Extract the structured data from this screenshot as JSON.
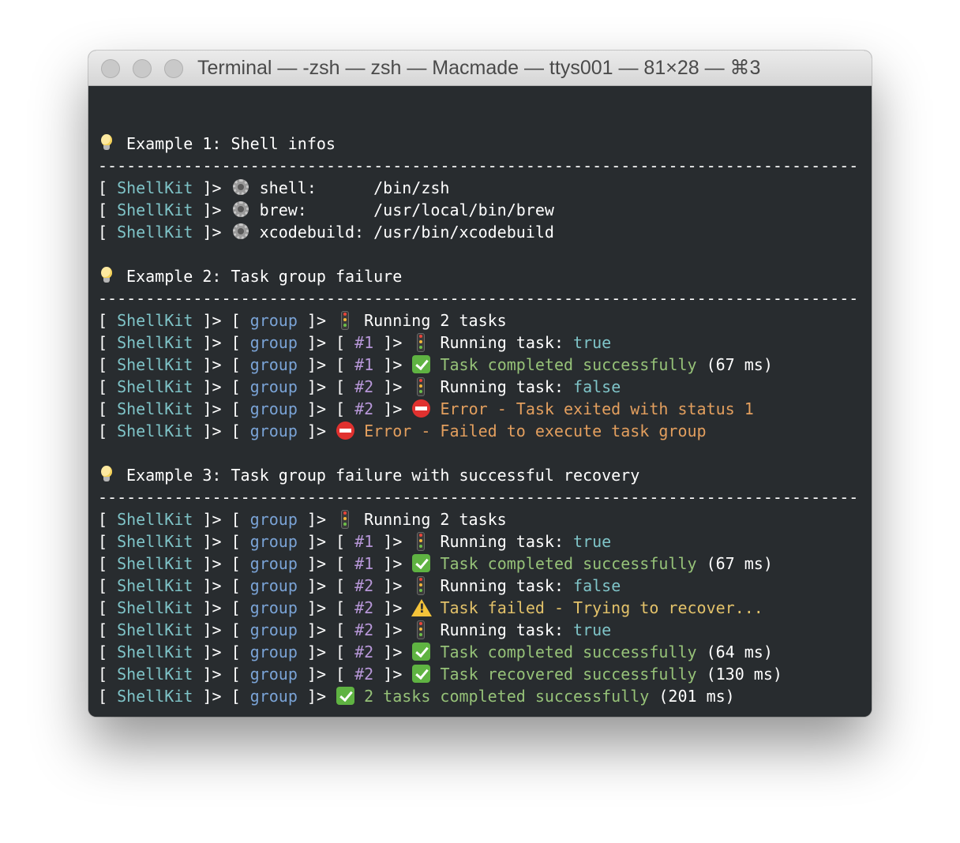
{
  "window": {
    "title": "Terminal — -zsh — zsh — Macmade — ttys001 — 81×28 — ⌘3"
  },
  "prefix": {
    "open": "[ ",
    "name": "ShellKit",
    "close": " ]>"
  },
  "separator": "--------------------------------------------------------------------------------",
  "lines": [
    {
      "type": "blank"
    },
    {
      "type": "segs",
      "segs": [
        [
          "emo",
          "bulb-icon"
        ],
        [
          "w",
          " Example 1: Shell infos"
        ]
      ]
    },
    {
      "type": "sep"
    },
    {
      "type": "segs",
      "segs": [
        [
          "prefix"
        ],
        [
          "w",
          " "
        ],
        [
          "emo",
          "gear-icon"
        ],
        [
          "w",
          " shell:      /bin/zsh"
        ]
      ]
    },
    {
      "type": "segs",
      "segs": [
        [
          "prefix"
        ],
        [
          "w",
          " "
        ],
        [
          "emo",
          "gear-icon"
        ],
        [
          "w",
          " brew:       /usr/local/bin/brew"
        ]
      ]
    },
    {
      "type": "segs",
      "segs": [
        [
          "prefix"
        ],
        [
          "w",
          " "
        ],
        [
          "emo",
          "gear-icon"
        ],
        [
          "w",
          " xcodebuild: /usr/bin/xcodebuild"
        ]
      ]
    },
    {
      "type": "blank"
    },
    {
      "type": "segs",
      "segs": [
        [
          "emo",
          "bulb-icon"
        ],
        [
          "w",
          " Example 2: Task group failure"
        ]
      ]
    },
    {
      "type": "sep"
    },
    {
      "type": "segs",
      "segs": [
        [
          "prefix"
        ],
        [
          "w",
          " [ "
        ],
        [
          "blue",
          "group"
        ],
        [
          "w",
          " ]> "
        ],
        [
          "emo",
          "traffic-light-icon"
        ],
        [
          "w",
          " Running 2 tasks"
        ]
      ]
    },
    {
      "type": "segs",
      "segs": [
        [
          "prefix"
        ],
        [
          "w",
          " [ "
        ],
        [
          "blue",
          "group"
        ],
        [
          "w",
          " ]> [ "
        ],
        [
          "purple",
          "#1"
        ],
        [
          "w",
          " ]> "
        ],
        [
          "emo",
          "traffic-light-icon"
        ],
        [
          "w",
          " Running task: "
        ],
        [
          "cyan",
          "true"
        ]
      ]
    },
    {
      "type": "segs",
      "segs": [
        [
          "prefix"
        ],
        [
          "w",
          " [ "
        ],
        [
          "blue",
          "group"
        ],
        [
          "w",
          " ]> [ "
        ],
        [
          "purple",
          "#1"
        ],
        [
          "w",
          " ]> "
        ],
        [
          "emo",
          "check-icon"
        ],
        [
          "green",
          " Task completed successfully"
        ],
        [
          "w",
          " (67 ms)"
        ]
      ]
    },
    {
      "type": "segs",
      "segs": [
        [
          "prefix"
        ],
        [
          "w",
          " [ "
        ],
        [
          "blue",
          "group"
        ],
        [
          "w",
          " ]> [ "
        ],
        [
          "purple",
          "#2"
        ],
        [
          "w",
          " ]> "
        ],
        [
          "emo",
          "traffic-light-icon"
        ],
        [
          "w",
          " Running task: "
        ],
        [
          "cyan",
          "false"
        ]
      ]
    },
    {
      "type": "segs",
      "segs": [
        [
          "prefix"
        ],
        [
          "w",
          " [ "
        ],
        [
          "blue",
          "group"
        ],
        [
          "w",
          " ]> [ "
        ],
        [
          "purple",
          "#2"
        ],
        [
          "w",
          " ]> "
        ],
        [
          "emo",
          "no-entry-icon"
        ],
        [
          "orange",
          " Error - Task exited with status 1"
        ]
      ]
    },
    {
      "type": "segs",
      "segs": [
        [
          "prefix"
        ],
        [
          "w",
          " [ "
        ],
        [
          "blue",
          "group"
        ],
        [
          "w",
          " ]> "
        ],
        [
          "emo",
          "no-entry-icon"
        ],
        [
          "orange",
          " Error - Failed to execute task group"
        ]
      ]
    },
    {
      "type": "blank"
    },
    {
      "type": "segs",
      "segs": [
        [
          "emo",
          "bulb-icon"
        ],
        [
          "w",
          " Example 3: Task group failure with successful recovery"
        ]
      ]
    },
    {
      "type": "sep"
    },
    {
      "type": "segs",
      "segs": [
        [
          "prefix"
        ],
        [
          "w",
          " [ "
        ],
        [
          "blue",
          "group"
        ],
        [
          "w",
          " ]> "
        ],
        [
          "emo",
          "traffic-light-icon"
        ],
        [
          "w",
          " Running 2 tasks"
        ]
      ]
    },
    {
      "type": "segs",
      "segs": [
        [
          "prefix"
        ],
        [
          "w",
          " [ "
        ],
        [
          "blue",
          "group"
        ],
        [
          "w",
          " ]> [ "
        ],
        [
          "purple",
          "#1"
        ],
        [
          "w",
          " ]> "
        ],
        [
          "emo",
          "traffic-light-icon"
        ],
        [
          "w",
          " Running task: "
        ],
        [
          "cyan",
          "true"
        ]
      ]
    },
    {
      "type": "segs",
      "segs": [
        [
          "prefix"
        ],
        [
          "w",
          " [ "
        ],
        [
          "blue",
          "group"
        ],
        [
          "w",
          " ]> [ "
        ],
        [
          "purple",
          "#1"
        ],
        [
          "w",
          " ]> "
        ],
        [
          "emo",
          "check-icon"
        ],
        [
          "green",
          " Task completed successfully"
        ],
        [
          "w",
          " (67 ms)"
        ]
      ]
    },
    {
      "type": "segs",
      "segs": [
        [
          "prefix"
        ],
        [
          "w",
          " [ "
        ],
        [
          "blue",
          "group"
        ],
        [
          "w",
          " ]> [ "
        ],
        [
          "purple",
          "#2"
        ],
        [
          "w",
          " ]> "
        ],
        [
          "emo",
          "traffic-light-icon"
        ],
        [
          "w",
          " Running task: "
        ],
        [
          "cyan",
          "false"
        ]
      ]
    },
    {
      "type": "segs",
      "segs": [
        [
          "prefix"
        ],
        [
          "w",
          " [ "
        ],
        [
          "blue",
          "group"
        ],
        [
          "w",
          " ]> [ "
        ],
        [
          "purple",
          "#2"
        ],
        [
          "w",
          " ]> "
        ],
        [
          "emo",
          "warning-icon"
        ],
        [
          "yellow",
          " Task failed - Trying to recover..."
        ]
      ]
    },
    {
      "type": "segs",
      "segs": [
        [
          "prefix"
        ],
        [
          "w",
          " [ "
        ],
        [
          "blue",
          "group"
        ],
        [
          "w",
          " ]> [ "
        ],
        [
          "purple",
          "#2"
        ],
        [
          "w",
          " ]> "
        ],
        [
          "emo",
          "traffic-light-icon"
        ],
        [
          "w",
          " Running task: "
        ],
        [
          "cyan",
          "true"
        ]
      ]
    },
    {
      "type": "segs",
      "segs": [
        [
          "prefix"
        ],
        [
          "w",
          " [ "
        ],
        [
          "blue",
          "group"
        ],
        [
          "w",
          " ]> [ "
        ],
        [
          "purple",
          "#2"
        ],
        [
          "w",
          " ]> "
        ],
        [
          "emo",
          "check-icon"
        ],
        [
          "green",
          " Task completed successfully"
        ],
        [
          "w",
          " (64 ms)"
        ]
      ]
    },
    {
      "type": "segs",
      "segs": [
        [
          "prefix"
        ],
        [
          "w",
          " [ "
        ],
        [
          "blue",
          "group"
        ],
        [
          "w",
          " ]> [ "
        ],
        [
          "purple",
          "#2"
        ],
        [
          "w",
          " ]> "
        ],
        [
          "emo",
          "check-icon"
        ],
        [
          "green",
          " Task recovered successfully"
        ],
        [
          "w",
          " (130 ms)"
        ]
      ]
    },
    {
      "type": "segs",
      "segs": [
        [
          "prefix"
        ],
        [
          "w",
          " [ "
        ],
        [
          "blue",
          "group"
        ],
        [
          "w",
          " ]> "
        ],
        [
          "emo",
          "check-icon"
        ],
        [
          "green",
          " 2 tasks completed successfully"
        ],
        [
          "w",
          " (201 ms)"
        ]
      ]
    }
  ],
  "colors": {
    "background": "#282c2f",
    "prefix_name": "#7fc4c8",
    "group": "#7aa3d6",
    "task_id": "#b797d8",
    "success": "#96c278",
    "error": "#e39f5e",
    "warning": "#e3c26a",
    "value": "#7fc4c8"
  }
}
